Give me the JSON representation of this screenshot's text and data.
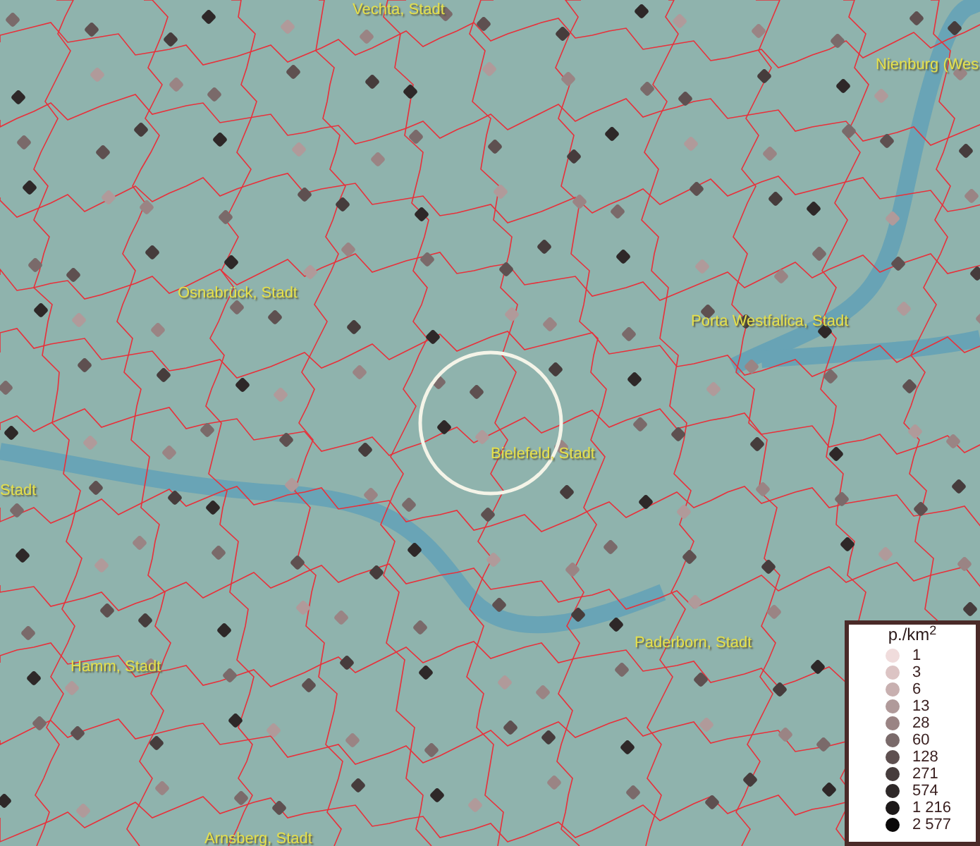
{
  "map": {
    "places": [
      {
        "name": "Vechta, Stadt"
      },
      {
        "name": "Nienburg (Wes"
      },
      {
        "name": "Osnabrück, Stadt"
      },
      {
        "name": "Porta Westfalica, Stadt"
      },
      {
        "name": "Bielefeld, Stadt"
      },
      {
        "name": "Stadt"
      },
      {
        "name": "Hamm, Stadt"
      },
      {
        "name": "Paderborn, Stadt"
      },
      {
        "name": "Arnsberg, Stadt"
      }
    ]
  },
  "legend": {
    "title": "p./km$^{2}$",
    "items": [
      {
        "label": "1",
        "color": "#f0dcdc"
      },
      {
        "label": "3",
        "color": "#dcc4c4"
      },
      {
        "label": "6",
        "color": "#c8b0b0"
      },
      {
        "label": "13",
        "color": "#b09a9a"
      },
      {
        "label": "28",
        "color": "#9a8484"
      },
      {
        "label": "60",
        "color": "#7a6a6a"
      },
      {
        "label": "128",
        "color": "#5e5050"
      },
      {
        "label": "271",
        "color": "#463c3c"
      },
      {
        "label": "574",
        "color": "#2e2828"
      },
      {
        "label": "1 216",
        "color": "#1c1818"
      },
      {
        "label": "2 577",
        "color": "#0a0808"
      }
    ]
  }
}
